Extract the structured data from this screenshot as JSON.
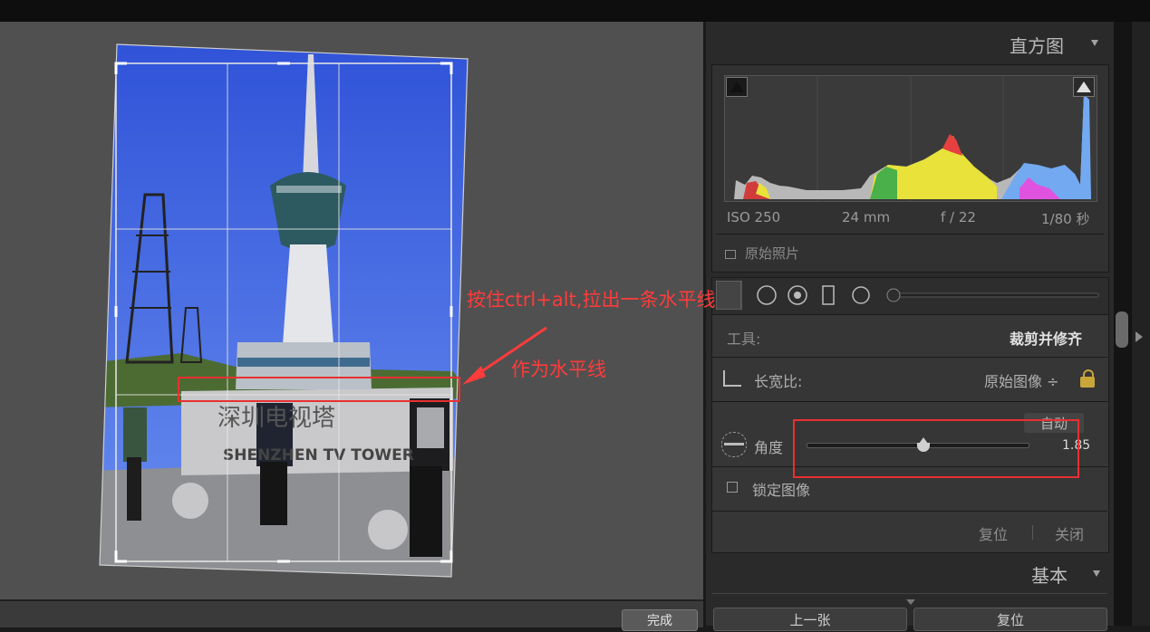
{
  "histogram": {
    "title": "直方图",
    "exif": {
      "iso": "ISO 250",
      "focal": "24 mm",
      "aperture": "f / 22",
      "shutter": "1/80 秒"
    },
    "original_photo_label": "原始照片"
  },
  "crop_tool": {
    "tool_label": "工具:",
    "tool_name": "裁剪并修齐",
    "aspect_label": "长宽比:",
    "aspect_value": "原始图像 ÷",
    "auto_button": "自动",
    "angle_label": "角度",
    "angle_value": "1.85",
    "angle_fraction": 0.53,
    "lock_image_label": "锁定图像",
    "reset_label": "复位",
    "close_label": "关闭"
  },
  "basic": {
    "title": "基本"
  },
  "bottom_buttons": {
    "done": "完成",
    "previous": "上一张",
    "reset": "复位"
  },
  "photo_sign": {
    "chinese": "深圳电视塔",
    "english": "SHENZHEN TV TOWER"
  },
  "annotations": {
    "instruction": "按住ctrl+alt,拉出一条水平线",
    "note": "作为水平线"
  },
  "colors": {
    "annotation": "#ff3b3b",
    "panel_bg": "#2a2a2a",
    "canvas_bg": "#505050"
  }
}
